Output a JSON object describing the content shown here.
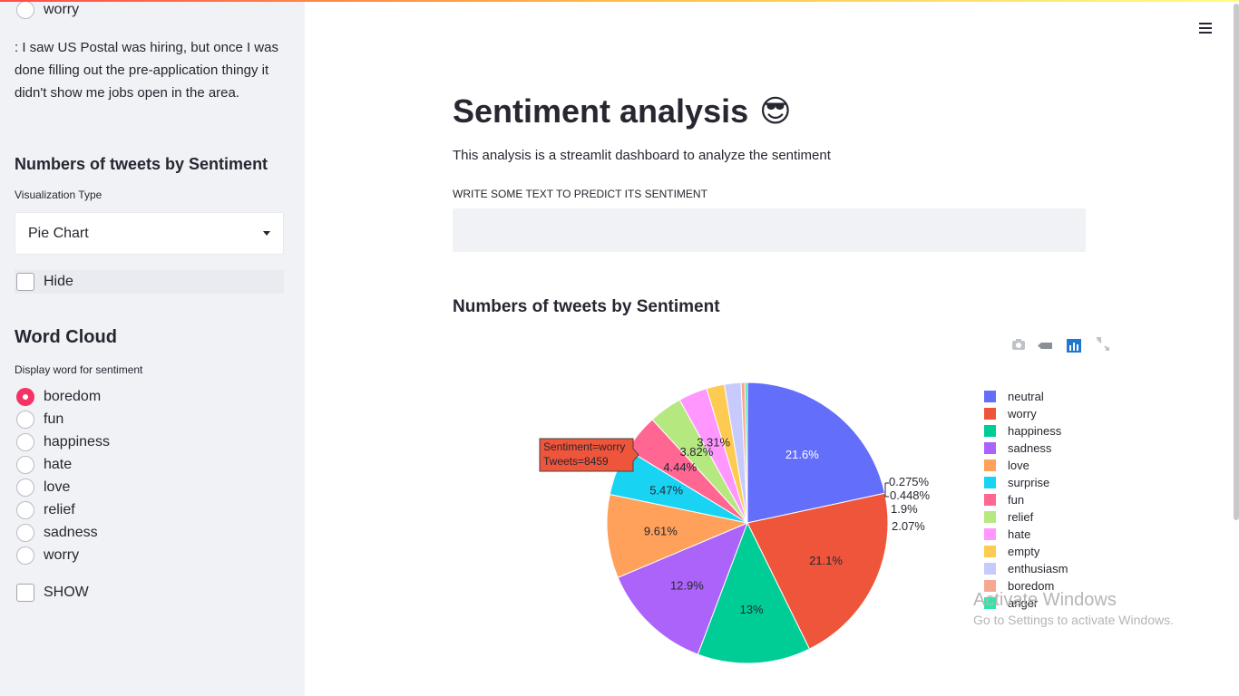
{
  "sidebar": {
    "top_radio_label": "worry",
    "tweet_text": ": I saw US Postal was hiring, but once I was done filling out the pre-application thingy it didn't show me jobs open in the area.",
    "tweets_heading": "Numbers of tweets by Sentiment",
    "viz_label": "Visualization Type",
    "viz_selected": "Pie Chart",
    "hide_label": "Hide",
    "wordcloud_heading": "Word Cloud",
    "wordcloud_label": "Display word for sentiment",
    "wordcloud_options": [
      "boredom",
      "fun",
      "happiness",
      "hate",
      "love",
      "relief",
      "sadness",
      "worry"
    ],
    "wordcloud_selected": "boredom",
    "show_label": "SHOW"
  },
  "main": {
    "title": "Sentiment analysis",
    "title_emoji": "😎",
    "subtitle": "This analysis is a streamlit dashboard to analyze the sentiment",
    "input_label": "WRITE SOME TEXT TO PREDICT ITS SENTIMENT",
    "input_value": "",
    "input_placeholder": "",
    "chart_section_title": "Numbers of tweets by Sentiment"
  },
  "tooltip": {
    "line1": "Sentiment=worry",
    "line2": "Tweets=8459",
    "color": "#ef553b"
  },
  "watermark": {
    "line1": "Activate Windows",
    "line2": "Go to Settings to activate Windows."
  },
  "modebar_icons": [
    "camera-icon",
    "tag-icon",
    "bar-chart-icon",
    "expand-icon"
  ],
  "chart_data": {
    "type": "pie",
    "labels": [
      "neutral",
      "worry",
      "happiness",
      "sadness",
      "love",
      "surprise",
      "fun",
      "relief",
      "hate",
      "empty",
      "enthusiasm",
      "boredom",
      "anger"
    ],
    "values": [
      21.6,
      21.1,
      13,
      12.9,
      9.61,
      5.47,
      4.44,
      3.82,
      3.31,
      2.07,
      1.9,
      0.448,
      0.275
    ],
    "slice_labels": [
      "21.6%",
      "21.1%",
      "13%",
      "12.9%",
      "9.61%",
      "5.47%",
      "4.44%",
      "3.82%",
      "3.31%",
      "2.07%",
      "1.9%",
      "0.448%",
      "0.275%"
    ],
    "colors": [
      "#636efa",
      "#ef553b",
      "#00cc96",
      "#ab63fa",
      "#ffa15a",
      "#19d3f3",
      "#ff6692",
      "#b6e880",
      "#ff97ff",
      "#fecb52",
      "#c6cafc",
      "#f6a891",
      "#2ee6a7"
    ],
    "legend_position": "right"
  }
}
